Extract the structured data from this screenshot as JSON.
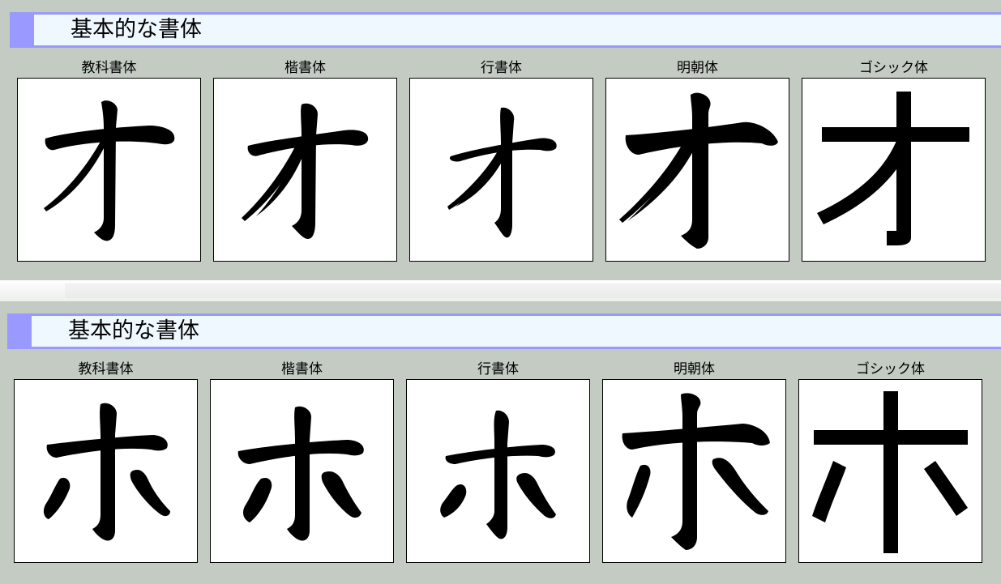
{
  "sections": [
    {
      "heading": "基本的な書体",
      "cards": [
        {
          "label": "教科書体",
          "glyph": "katakana-o-kyokasho"
        },
        {
          "label": "楷書体",
          "glyph": "katakana-o-kaisho"
        },
        {
          "label": "行書体",
          "glyph": "katakana-o-gyosho"
        },
        {
          "label": "明朝体",
          "glyph": "katakana-o-mincho"
        },
        {
          "label": "ゴシック体",
          "glyph": "katakana-o-gothic"
        }
      ]
    },
    {
      "heading": "基本的な書体",
      "cards": [
        {
          "label": "教科書体",
          "glyph": "katakana-ho-kyokasho"
        },
        {
          "label": "楷書体",
          "glyph": "katakana-ho-kaisho"
        },
        {
          "label": "行書体",
          "glyph": "katakana-ho-gyosho"
        },
        {
          "label": "明朝体",
          "glyph": "katakana-ho-mincho"
        },
        {
          "label": "ゴシック体",
          "glyph": "katakana-ho-gothic"
        }
      ]
    }
  ],
  "colors": {
    "page_background": "#c3cbc3",
    "heading_background": "#f0f8ff",
    "heading_accent": "#9999ff",
    "card_background": "#ffffff",
    "glyph": "#000000"
  }
}
